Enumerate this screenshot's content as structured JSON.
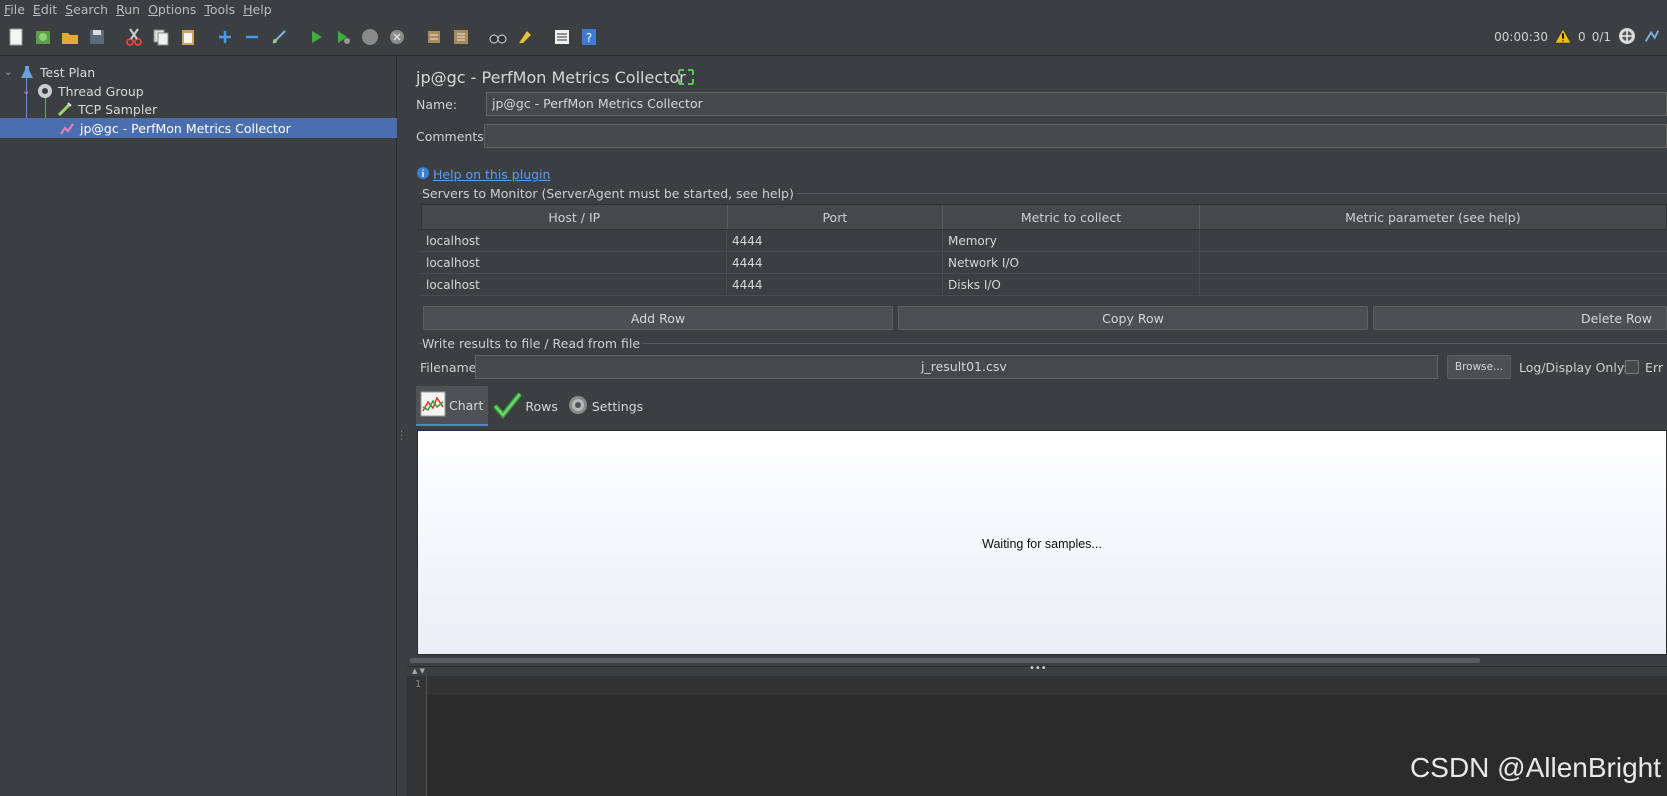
{
  "menu": [
    "File",
    "Edit",
    "Search",
    "Run",
    "Options",
    "Tools",
    "Help"
  ],
  "toolbar_status": {
    "timer": "00:00:30",
    "warnings": "0",
    "threads": "0/1"
  },
  "tree": {
    "items": [
      {
        "label": "Test Plan",
        "icon": "test-plan-icon"
      },
      {
        "label": "Thread Group",
        "icon": "gear-icon"
      },
      {
        "label": "TCP Sampler",
        "icon": "pipette-icon"
      },
      {
        "label": "jp@gc - PerfMon Metrics Collector",
        "icon": "perfmon-icon",
        "selected": true
      }
    ]
  },
  "panel": {
    "title": "jp@gc - PerfMon Metrics Collector",
    "name_label": "Name:",
    "name_value": "jp@gc - PerfMon Metrics Collector",
    "comments_label": "Comments:",
    "comments_value": "",
    "help_link": "Help on this plugin",
    "servers_group": "Servers to Monitor (ServerAgent must be started, see help)",
    "table": {
      "headers": [
        "Host / IP",
        "Port",
        "Metric to collect",
        "Metric parameter (see help)"
      ],
      "rows": [
        [
          "localhost",
          "4444",
          "Memory",
          ""
        ],
        [
          "localhost",
          "4444",
          "Network I/O",
          ""
        ],
        [
          "localhost",
          "4444",
          "Disks I/O",
          ""
        ]
      ]
    },
    "buttons": {
      "add_row": "Add Row",
      "copy_row": "Copy Row",
      "delete_row": "Delete Row"
    },
    "file_group": "Write results to file / Read from file",
    "filename_label": "Filename",
    "filename_value": "j_result01.csv",
    "browse": "Browse...",
    "log_display_only": "Log/Display Only:",
    "errors_cb": "Err",
    "tabs": [
      "Chart",
      "Rows",
      "Settings"
    ],
    "chart_message": "Waiting for samples...",
    "log_line_number": "1"
  },
  "watermark": "CSDN @AllenBright"
}
